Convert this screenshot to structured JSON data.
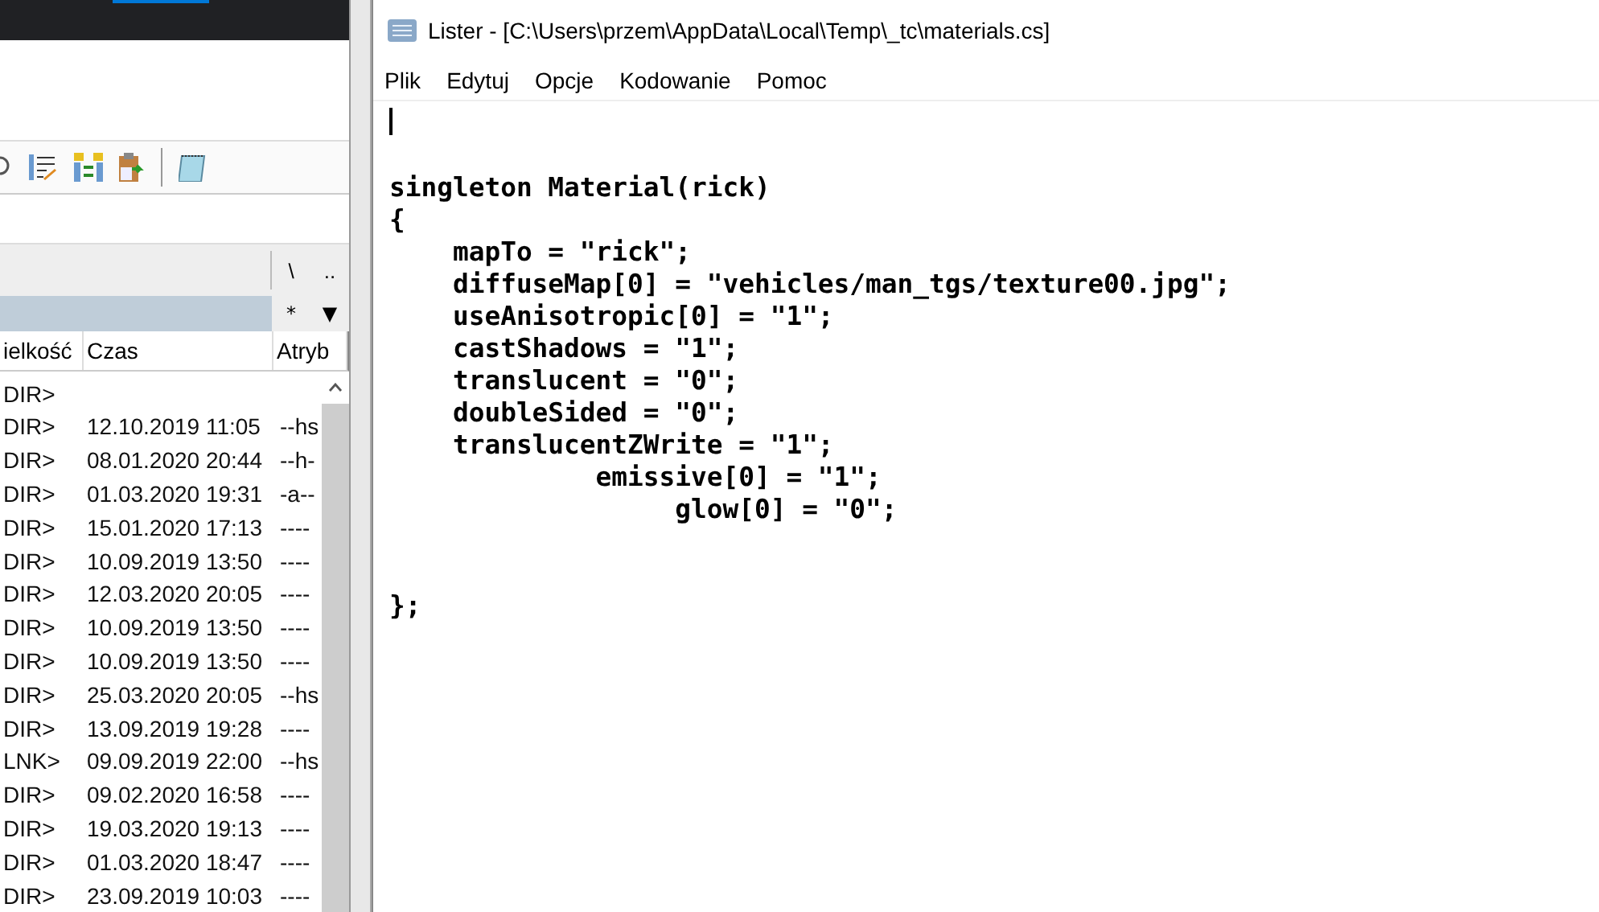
{
  "file_panel": {
    "nav_buttons": [
      "\\",
      ".."
    ],
    "filter_buttons": [
      "*",
      "▼"
    ],
    "columns": [
      "ielkość",
      "Czas",
      "Atryb"
    ],
    "rows": [
      {
        "size": "DIR>",
        "time": "",
        "attr": ""
      },
      {
        "size": "DIR>",
        "time": "12.10.2019 11:05",
        "attr": "--hs"
      },
      {
        "size": "DIR>",
        "time": "08.01.2020 20:44",
        "attr": "--h-"
      },
      {
        "size": "DIR>",
        "time": "01.03.2020 19:31",
        "attr": "-a--"
      },
      {
        "size": "DIR>",
        "time": "15.01.2020 17:13",
        "attr": "----"
      },
      {
        "size": "DIR>",
        "time": "10.09.2019 13:50",
        "attr": "----"
      },
      {
        "size": "DIR>",
        "time": "12.03.2020 20:05",
        "attr": "----"
      },
      {
        "size": "DIR>",
        "time": "10.09.2019 13:50",
        "attr": "----"
      },
      {
        "size": "DIR>",
        "time": "10.09.2019 13:50",
        "attr": "----"
      },
      {
        "size": "DIR>",
        "time": "25.03.2020 20:05",
        "attr": "--hs"
      },
      {
        "size": "DIR>",
        "time": "13.09.2019 19:28",
        "attr": "----"
      },
      {
        "size": "LNK>",
        "time": "09.09.2019 22:00",
        "attr": "--hs"
      },
      {
        "size": "DIR>",
        "time": "09.02.2020 16:58",
        "attr": "----"
      },
      {
        "size": "DIR>",
        "time": "19.03.2020 19:13",
        "attr": "----"
      },
      {
        "size": "DIR>",
        "time": "01.03.2020 18:47",
        "attr": "----"
      },
      {
        "size": "DIR>",
        "time": "23.09.2019 10:03",
        "attr": "----"
      }
    ]
  },
  "lister": {
    "title": "Lister - [C:\\Users\\przem\\AppData\\Local\\Temp\\_tc\\materials.cs]",
    "menu": [
      "Plik",
      "Edytuj",
      "Opcje",
      "Kodowanie",
      "Pomoc"
    ],
    "lines": [
      "singleton Material(rick)",
      "{",
      "    mapTo = \"rick\";",
      "    diffuseMap[0] = \"vehicles/man_tgs/texture00.jpg\";",
      "    useAnisotropic[0] = \"1\";",
      "    castShadows = \"1\";",
      "    translucent = \"0\";",
      "    doubleSided = \"0\";",
      "    translucentZWrite = \"1\";",
      "             emissive[0] = \"1\";",
      "                  glow[0] = \"0\";"
    ],
    "closing_lines": [
      "};"
    ]
  }
}
